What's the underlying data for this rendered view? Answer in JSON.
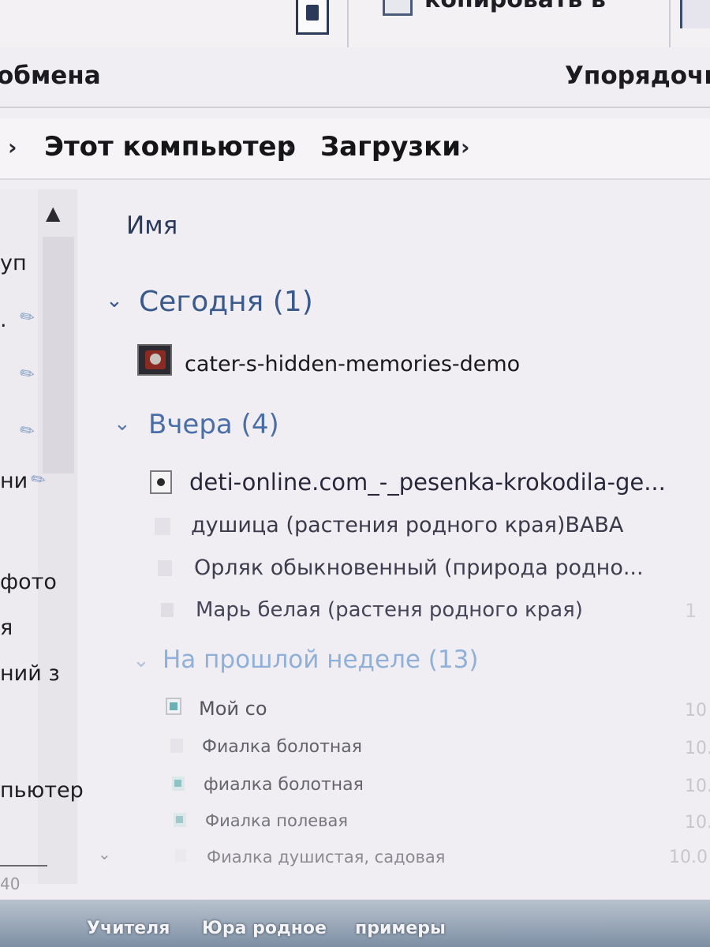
{
  "ribbon": {
    "copy_to_label": "копировать в",
    "clipboard_group_label": "обмена",
    "organize_group_label": "Упорядочи"
  },
  "breadcrumb": {
    "items": [
      "Этот компьютер",
      "Загрузки"
    ]
  },
  "nav_pane": {
    "items": [
      "уп",
      ".",
      "",
      "",
      "ни",
      "фото",
      "я",
      "ний з",
      "пьютер"
    ],
    "bottom_text": "40"
  },
  "file_list": {
    "column_header": "Имя",
    "groups": [
      {
        "label": "Сегодня (1)",
        "files": [
          {
            "name": "cater-s-hidden-memories-demo",
            "date": ""
          }
        ]
      },
      {
        "label": "Вчера (4)",
        "files": [
          {
            "name": "deti-online.com_-_pesenka-krokodila-ge...",
            "date": ""
          },
          {
            "name": "душица (растения родного края)ВАВА",
            "date": ""
          },
          {
            "name": "Орляк обыкновенный (природа родно...",
            "date": ""
          },
          {
            "name": "Марь белая (растеня родного края)",
            "date": "1"
          }
        ]
      },
      {
        "label": "На прошлой неделе (13)",
        "files": [
          {
            "name": "Мой со",
            "date": "10"
          },
          {
            "name": "Фиалка болотная",
            "date": "10."
          },
          {
            "name": "фиалка болотная",
            "date": "10.0"
          },
          {
            "name": "Фиалка полевая",
            "date": "10.0"
          },
          {
            "name": "Фиалка душистая, садовая",
            "date": "10.0"
          }
        ]
      }
    ]
  },
  "taskbar": {
    "items": [
      "Учителя",
      "Юра родное",
      "примеры"
    ]
  },
  "colors": {
    "group_header_today": "#3a5a8c",
    "group_header_yesterday": "#4a6fa8",
    "group_header_last_week": "#8fb0d8",
    "window_background": "#f1eef3"
  }
}
